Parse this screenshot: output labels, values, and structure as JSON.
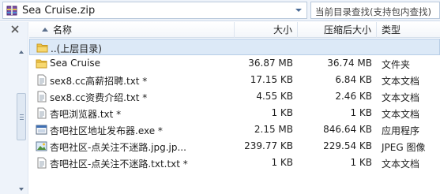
{
  "address_bar": {
    "archive_name": "Sea Cruise.zip",
    "search_placeholder": "当前目录查找(支持包内查找)"
  },
  "columns": {
    "name": "名称",
    "size": "大小",
    "packed_size": "压缩后大小",
    "type": "类型"
  },
  "parent_row": {
    "label": "..(上层目录)"
  },
  "files": [
    {
      "icon": "folder-icon",
      "name": "Sea Cruise",
      "size": "36.87 MB",
      "packed": "36.74 MB",
      "type": "文件夹"
    },
    {
      "icon": "text-file-icon",
      "name": "sex8.cc高薪招聘.txt *",
      "size": "17.15 KB",
      "packed": "6.84 KB",
      "type": "文本文档"
    },
    {
      "icon": "text-file-icon",
      "name": "sex8.cc资费介绍.txt *",
      "size": "4.55 KB",
      "packed": "2.46 KB",
      "type": "文本文档"
    },
    {
      "icon": "text-file-icon",
      "name": "杏吧浏览器.txt *",
      "size": "1 KB",
      "packed": "1 KB",
      "type": "文本文档"
    },
    {
      "icon": "exe-file-icon",
      "name": "杏吧社区地址发布器.exe *",
      "size": "2.15 MB",
      "packed": "846.64 KB",
      "type": "应用程序"
    },
    {
      "icon": "image-file-icon",
      "name": "杏吧社区-点关注不迷路.jpg.jp...",
      "size": "239.77 KB",
      "packed": "229.54 KB",
      "type": "JPEG 图像"
    },
    {
      "icon": "text-file-icon",
      "name": "杏吧社区-点关注不迷路.txt.txt *",
      "size": "1 KB",
      "packed": "1 KB",
      "type": "文本文档"
    }
  ]
}
